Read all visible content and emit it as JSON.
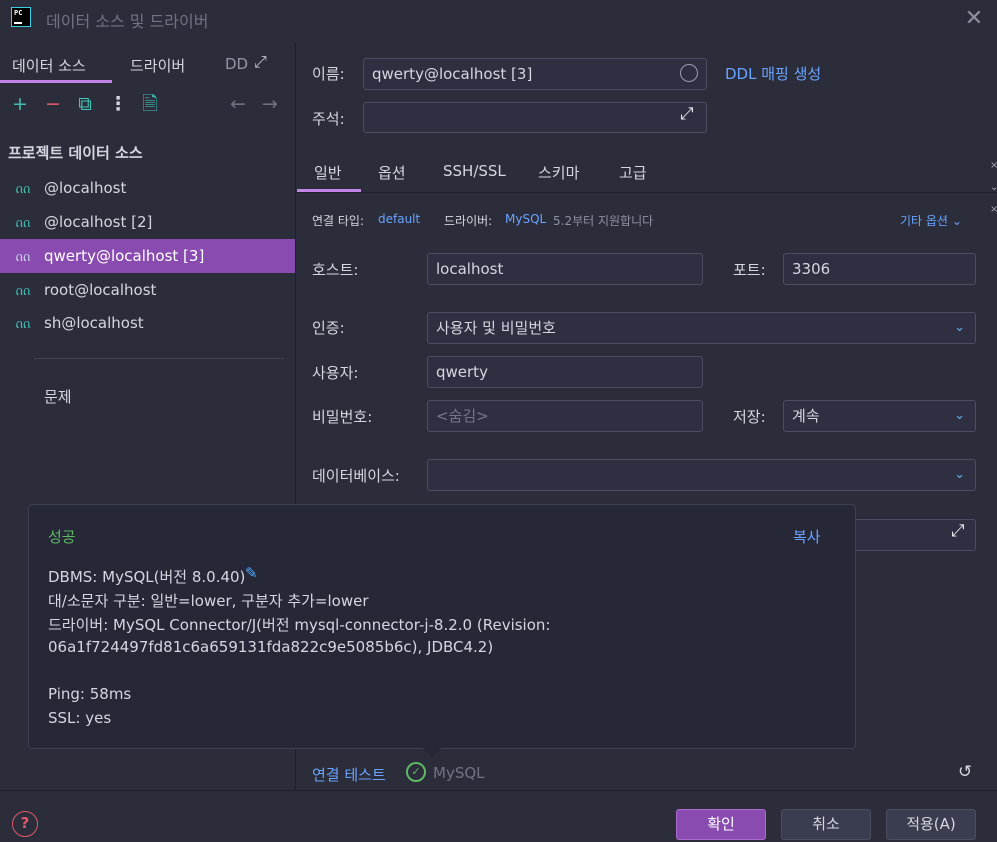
{
  "window": {
    "title": "데이터 소스 및 드라이버"
  },
  "left": {
    "tabs": [
      "데이터 소스",
      "드라이버",
      "DD"
    ],
    "toolbar": {
      "add": "+",
      "remove": "−",
      "copy": "⧉",
      "more": "⋮",
      "import": "🗎",
      "back": "←",
      "forward": "→"
    },
    "section_heading": "프로젝트 데이터 소스",
    "items": [
      {
        "label": "@localhost"
      },
      {
        "label": "@localhost [2]"
      },
      {
        "label": "qwerty@localhost [3]"
      },
      {
        "label": "root@localhost"
      },
      {
        "label": "sh@localhost"
      }
    ],
    "problems": "문제"
  },
  "right": {
    "name_label": "이름:",
    "name_value": "qwerty@localhost [3]",
    "ddl_link": "DDL 매핑 생성",
    "comment_label": "주석:",
    "comment_value": "",
    "tabs": [
      "일반",
      "옵션",
      "SSH/SSL",
      "스키마",
      "고급"
    ],
    "conn_type_label": "연결 타입:",
    "conn_type_value": "default",
    "driver_label": "드라이버:",
    "driver_value": "MySQL",
    "driver_note": "5.2부터 지원합니다",
    "more_options": "기타 옵션",
    "host_label": "호스트:",
    "host_value": "localhost",
    "port_label": "포트:",
    "port_value": "3306",
    "auth_label": "인증:",
    "auth_value": "사용자 및 비밀번호",
    "user_label": "사용자:",
    "user_value": "qwerty",
    "password_label": "비밀번호:",
    "password_placeholder": "<숨김>",
    "save_label": "저장:",
    "save_value": "계속",
    "database_label": "데이터베이스:",
    "database_value": ""
  },
  "popup": {
    "status": "성공",
    "copy": "복사",
    "lines": [
      "DBMS: MySQL(버전 8.0.40)",
      "대/소문자 구분: 일반=lower, 구분자 추가=lower",
      "드라이버: MySQL Connector/J(버전 mysql-connector-j-8.2.0 (Revision:",
      "06a1f724497fd81c6a659131fda822c9e5085b6c), JDBC4.2)",
      "Ping: 58ms",
      "SSL: yes"
    ]
  },
  "test": {
    "label": "연결 테스트",
    "driver": "MySQL"
  },
  "buttons": {
    "ok": "확인",
    "cancel": "취소",
    "apply": "적용(A)",
    "help": "?"
  }
}
